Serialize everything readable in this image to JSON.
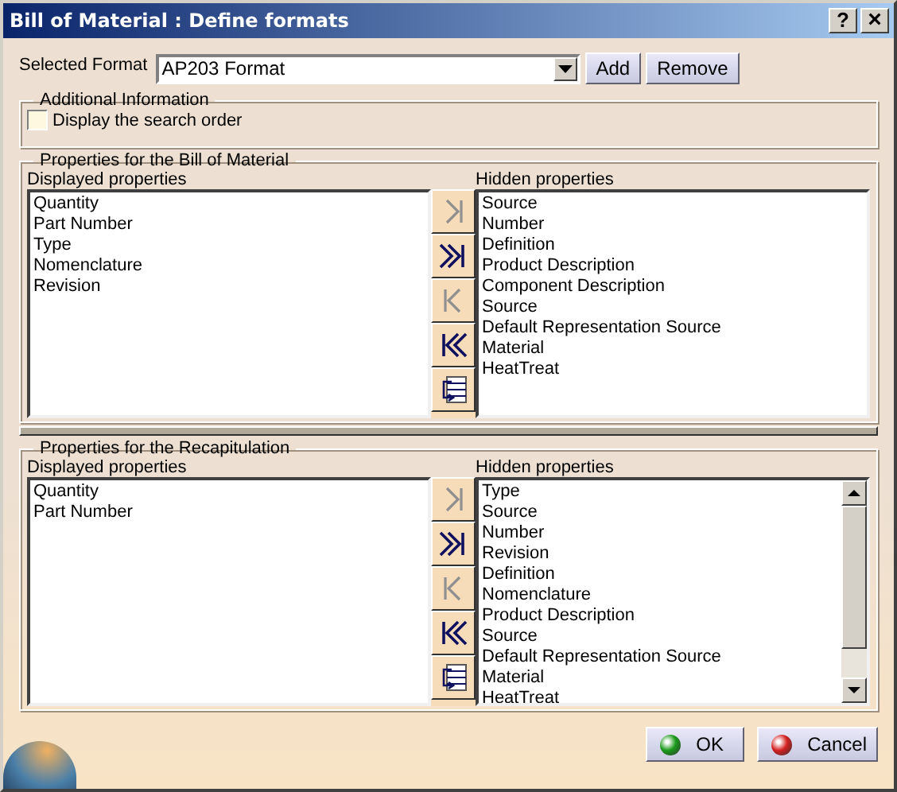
{
  "window": {
    "title": "Bill of Material : Define formats",
    "buttons": [
      {
        "kind": "help",
        "label": "?"
      },
      {
        "kind": "close",
        "label": "×"
      }
    ]
  },
  "format": {
    "label": "Selected Format",
    "value": "AP203 Format",
    "buttons": [
      "Add",
      "Remove"
    ]
  },
  "additional": {
    "title": "Additional Information",
    "checkbox": {
      "label": "Display the search order",
      "checked": false
    }
  },
  "sections": [
    {
      "title": "Properties for the Bill of Material",
      "displayed_label": "Displayed properties",
      "hidden_label": "Hidden properties",
      "displayed": [
        "Quantity",
        "Part Number",
        "Type",
        "Nomenclature",
        "Revision"
      ],
      "hidden": [
        "Source",
        "Number",
        "Definition",
        "Product Description",
        "Component Description",
        "Source",
        "Default Representation Source",
        "Material",
        "HeatTreat"
      ],
      "scrollbar": false,
      "transfer_buttons": [
        {
          "kind": "move-one-right",
          "disabled": true
        },
        {
          "kind": "move-all-right",
          "disabled": false
        },
        {
          "kind": "move-one-left",
          "disabled": true
        },
        {
          "kind": "move-all-left",
          "disabled": false
        },
        {
          "kind": "order",
          "disabled": false
        }
      ]
    },
    {
      "title": "Properties for the Recapitulation",
      "displayed_label": "Displayed properties",
      "hidden_label": "Hidden properties",
      "displayed": [
        "Quantity",
        "Part Number"
      ],
      "hidden": [
        "Type",
        "Source",
        "Number",
        "Revision",
        "Definition",
        "Nomenclature",
        "Product Description",
        "Source",
        "Default Representation Source",
        "Material",
        "HeatTreat"
      ],
      "scrollbar": true,
      "transfer_buttons": [
        {
          "kind": "move-one-right",
          "disabled": true
        },
        {
          "kind": "move-all-right",
          "disabled": false
        },
        {
          "kind": "move-one-left",
          "disabled": true
        },
        {
          "kind": "move-all-left",
          "disabled": false
        },
        {
          "kind": "order",
          "disabled": false
        }
      ]
    }
  ],
  "footer": {
    "buttons": [
      {
        "kind": "ok",
        "label": "OK"
      },
      {
        "kind": "cancel",
        "label": "Cancel"
      }
    ]
  }
}
